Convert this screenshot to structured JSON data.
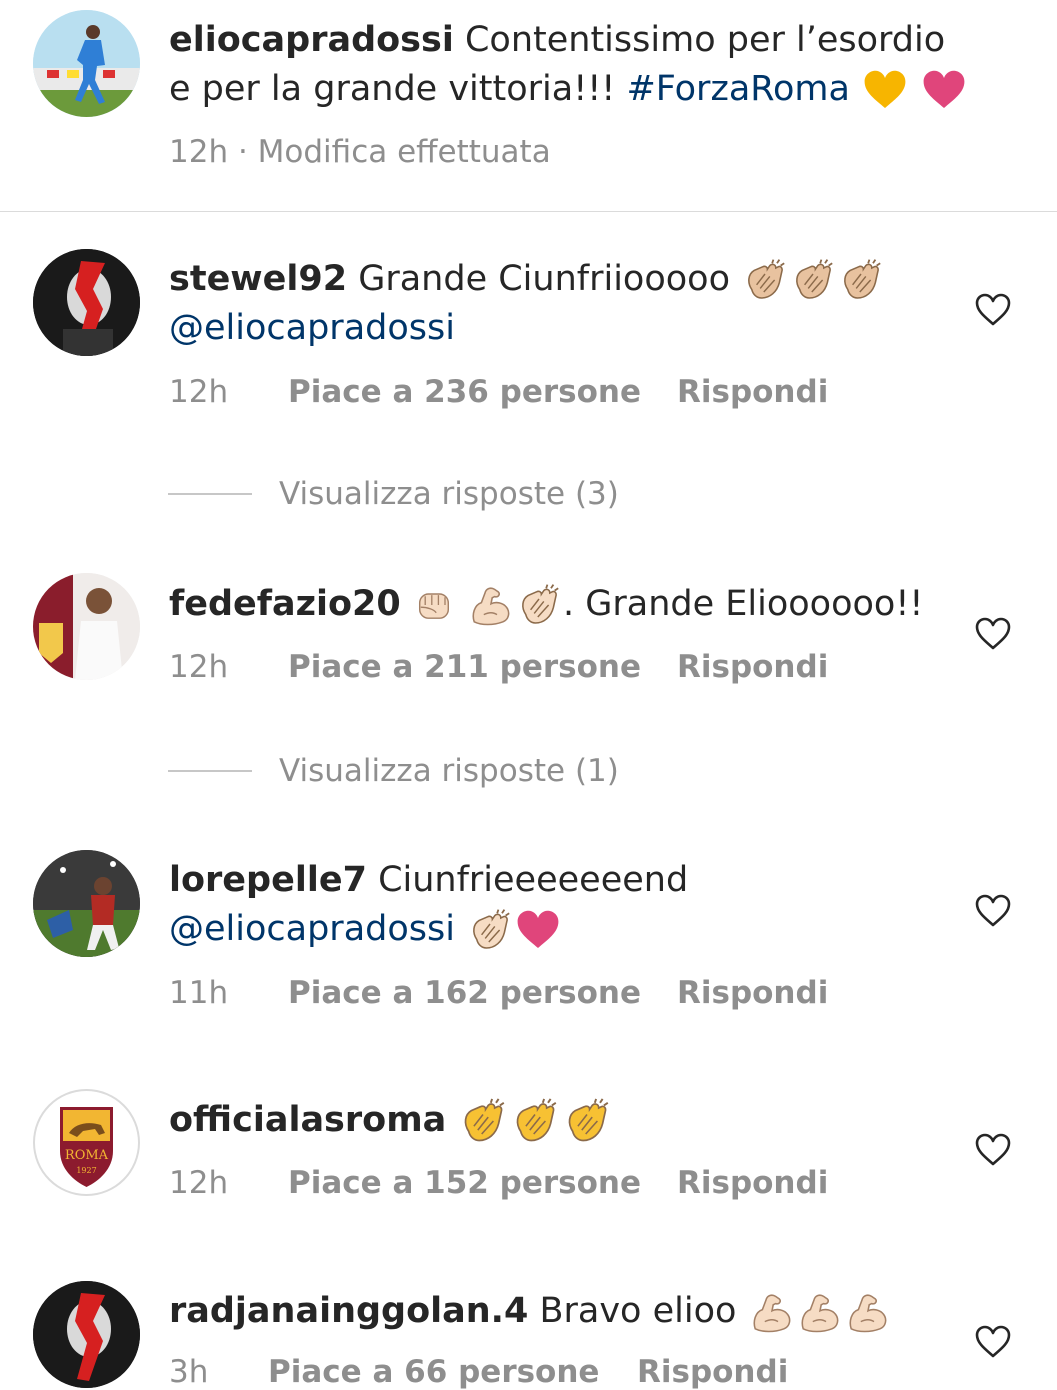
{
  "caption": {
    "username": "eliocapradossi",
    "text_line1": "Contentissimo per l’esordio",
    "text_line2": "e per la grande vittoria!!!",
    "hashtag": "#ForzaRoma",
    "time": "12h",
    "edited": "· Modifica effettuata"
  },
  "comments": [
    {
      "username": "stewel92",
      "text": "Grande Ciunfriiooooo",
      "mention": "@eliocapradossi",
      "time": "12h",
      "likes": "Piace a 236 persone",
      "reply": "Rispondi",
      "view_replies": "Visualizza risposte (3)"
    },
    {
      "username": "fedefazio20",
      "text": ". Grande Elioooooo!!",
      "time": "12h",
      "likes": "Piace a 211 persone",
      "reply": "Rispondi",
      "view_replies": "Visualizza risposte (1)"
    },
    {
      "username": "lorepelle7",
      "text": "Ciunfrieeeeeeend",
      "mention": "@eliocapradossi",
      "time": "11h",
      "likes": "Piace a 162 persone",
      "reply": "Rispondi"
    },
    {
      "username": "officialasroma",
      "avatar_text": "ROMA",
      "avatar_year": "1927",
      "time": "12h",
      "likes": "Piace a 152 persone",
      "reply": "Rispondi"
    },
    {
      "username": "radjanainggolan.4",
      "text": "Bravo elioo",
      "time": "3h",
      "likes": "Piace a 66 persone",
      "reply": "Rispondi"
    }
  ],
  "colors": {
    "hashtag": "#003569",
    "meta": "#8e8e8e",
    "heart_pink": "#e0457b",
    "heart_yellow": "#f7b500"
  }
}
